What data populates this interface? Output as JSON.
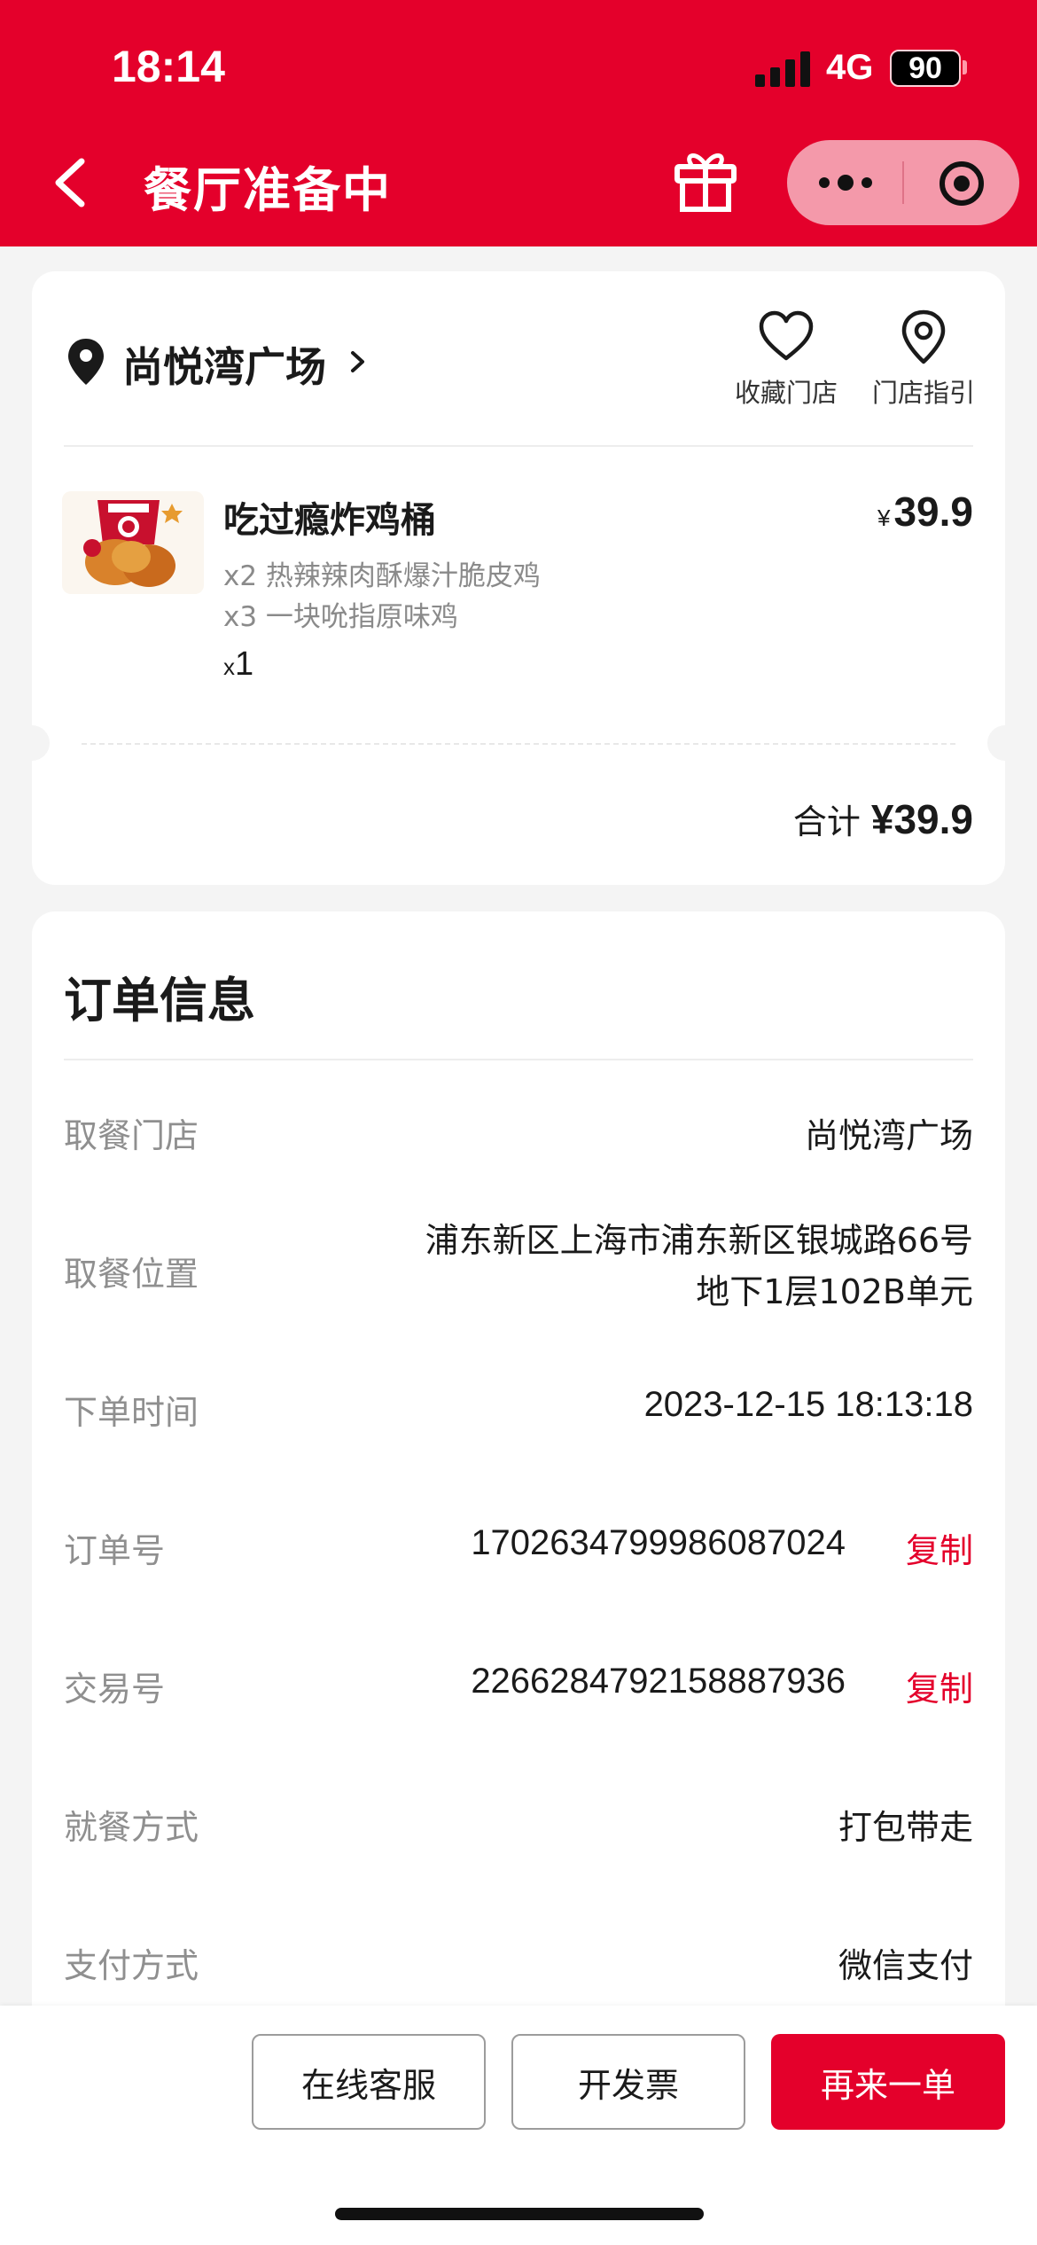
{
  "status_bar": {
    "time": "18:14",
    "network": "4G",
    "battery": "90"
  },
  "header": {
    "title": "餐厅准备中"
  },
  "store": {
    "name": "尚悦湾广场",
    "favorite_label": "收藏门店",
    "guide_label": "门店指引"
  },
  "order_item": {
    "name": "吃过瘾炸鸡桶",
    "price_symbol": "¥",
    "price": "39.9",
    "sub_items": [
      "x2 热辣辣肉酥爆汁脆皮鸡",
      "x3 一块吮指原味鸡"
    ],
    "qty_prefix": "x",
    "qty": "1"
  },
  "summary": {
    "label": "合计",
    "amount": "¥39.9"
  },
  "order_info": {
    "title": "订单信息",
    "rows": [
      {
        "label": "取餐门店",
        "value": "尚悦湾广场"
      },
      {
        "label": "取餐位置",
        "value_line1": "浦东新区上海市浦东新区银城路66号",
        "value_line2": "地下1层102B单元"
      },
      {
        "label": "下单时间",
        "value": "2023-12-15 18:13:18"
      },
      {
        "label": "订单号",
        "value": "1702634799986087024",
        "action": "复制"
      },
      {
        "label": "交易号",
        "value": "2266284792158887936",
        "action": "复制"
      },
      {
        "label": "就餐方式",
        "value": "打包带走"
      },
      {
        "label": "支付方式",
        "value": "微信支付"
      }
    ]
  },
  "bottom_bar": {
    "service": "在线客服",
    "invoice": "开发票",
    "reorder": "再来一单"
  },
  "colors": {
    "brand": "#e4002b",
    "background": "#f4f4f4"
  }
}
